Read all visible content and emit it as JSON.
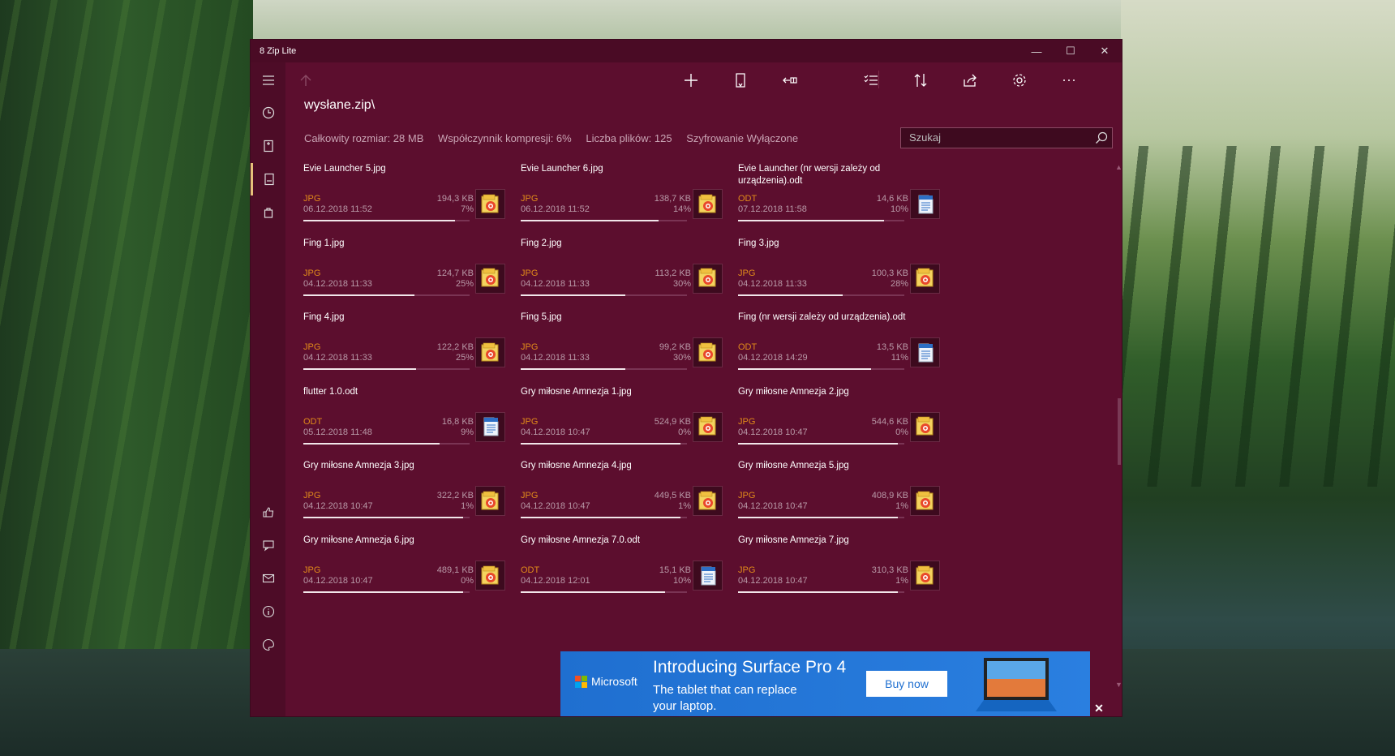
{
  "window": {
    "title": "8 Zip Lite"
  },
  "window_controls": {
    "minimize": "—",
    "maximize": "☐",
    "close": "✕"
  },
  "path": "wysłane.zip\\",
  "stats": {
    "total_size": "Całkowity rozmiar: 28 MB",
    "compression": "Współczynnik kompresji: 6%",
    "file_count": "Liczba plików: 125",
    "encryption": "Szyfrowanie Wyłączone"
  },
  "search": {
    "placeholder": "Szukaj"
  },
  "files": [
    {
      "name": "Evie Launcher 5.jpg",
      "type": "JPG",
      "date": "06.12.2018 11:52",
      "size": "194,3 KB",
      "ratio": "7%",
      "icon": "jpg-icon",
      "progress": 0.91
    },
    {
      "name": "Evie Launcher 6.jpg",
      "type": "JPG",
      "date": "06.12.2018 11:52",
      "size": "138,7 KB",
      "ratio": "14%",
      "icon": "jpg-icon",
      "progress": 0.83
    },
    {
      "name": "Evie Launcher (nr wersji zależy od urządzenia).odt",
      "type": "ODT",
      "date": "07.12.2018 11:58",
      "size": "14,6 KB",
      "ratio": "10%",
      "icon": "odt-icon",
      "progress": 0.88
    },
    {
      "name": "Fing 1.jpg",
      "type": "JPG",
      "date": "04.12.2018 11:33",
      "size": "124,7 KB",
      "ratio": "25%",
      "icon": "jpg-icon",
      "progress": 0.67
    },
    {
      "name": "Fing 2.jpg",
      "type": "JPG",
      "date": "04.12.2018 11:33",
      "size": "113,2 KB",
      "ratio": "30%",
      "icon": "jpg-icon",
      "progress": 0.63
    },
    {
      "name": "Fing 3.jpg",
      "type": "JPG",
      "date": "04.12.2018 11:33",
      "size": "100,3 KB",
      "ratio": "28%",
      "icon": "jpg-icon",
      "progress": 0.63
    },
    {
      "name": "Fing 4.jpg",
      "type": "JPG",
      "date": "04.12.2018 11:33",
      "size": "122,2 KB",
      "ratio": "25%",
      "icon": "jpg-icon",
      "progress": 0.68
    },
    {
      "name": "Fing 5.jpg",
      "type": "JPG",
      "date": "04.12.2018 11:33",
      "size": "99,2 KB",
      "ratio": "30%",
      "icon": "jpg-icon",
      "progress": 0.63
    },
    {
      "name": "Fing (nr wersji zależy od urządzenia).odt",
      "type": "ODT",
      "date": "04.12.2018 14:29",
      "size": "13,5 KB",
      "ratio": "11%",
      "icon": "odt-icon",
      "progress": 0.8
    },
    {
      "name": "flutter 1.0.odt",
      "type": "ODT",
      "date": "05.12.2018 11:48",
      "size": "16,8 KB",
      "ratio": "9%",
      "icon": "odt-icon",
      "progress": 0.82
    },
    {
      "name": "Gry miłosne Amnezja 1.jpg",
      "type": "JPG",
      "date": "04.12.2018 10:47",
      "size": "524,9 KB",
      "ratio": "0%",
      "icon": "jpg-icon",
      "progress": 0.96
    },
    {
      "name": "Gry miłosne Amnezja 2.jpg",
      "type": "JPG",
      "date": "04.12.2018 10:47",
      "size": "544,6 KB",
      "ratio": "0%",
      "icon": "jpg-icon",
      "progress": 0.96
    },
    {
      "name": "Gry miłosne Amnezja 3.jpg",
      "type": "JPG",
      "date": "04.12.2018 10:47",
      "size": "322,2 KB",
      "ratio": "1%",
      "icon": "jpg-icon",
      "progress": 0.96
    },
    {
      "name": "Gry miłosne Amnezja 4.jpg",
      "type": "JPG",
      "date": "04.12.2018 10:47",
      "size": "449,5 KB",
      "ratio": "1%",
      "icon": "jpg-icon",
      "progress": 0.96
    },
    {
      "name": "Gry miłosne Amnezja 5.jpg",
      "type": "JPG",
      "date": "04.12.2018 10:47",
      "size": "408,9 KB",
      "ratio": "1%",
      "icon": "jpg-icon",
      "progress": 0.96
    },
    {
      "name": "Gry miłosne Amnezja 6.jpg",
      "type": "JPG",
      "date": "04.12.2018 10:47",
      "size": "489,1 KB",
      "ratio": "0%",
      "icon": "jpg-icon",
      "progress": 0.96
    },
    {
      "name": "Gry miłosne Amnezja 7.0.odt",
      "type": "ODT",
      "date": "04.12.2018 12:01",
      "size": "15,1 KB",
      "ratio": "10%",
      "icon": "odt-icon",
      "progress": 0.87
    },
    {
      "name": "Gry miłosne Amnezja 7.jpg",
      "type": "JPG",
      "date": "04.12.2018 10:47",
      "size": "310,3 KB",
      "ratio": "1%",
      "icon": "jpg-icon",
      "progress": 0.96
    }
  ],
  "ad": {
    "brand": "Microsoft",
    "headline": "Introducing Surface Pro 4",
    "subline": "The tablet that can replace your laptop.",
    "button": "Buy now",
    "close": "✕"
  },
  "colors": {
    "window_bg": "#5c0e2e",
    "accent_type": "#e08a1a",
    "ad_blue": "#1f6fd0"
  }
}
